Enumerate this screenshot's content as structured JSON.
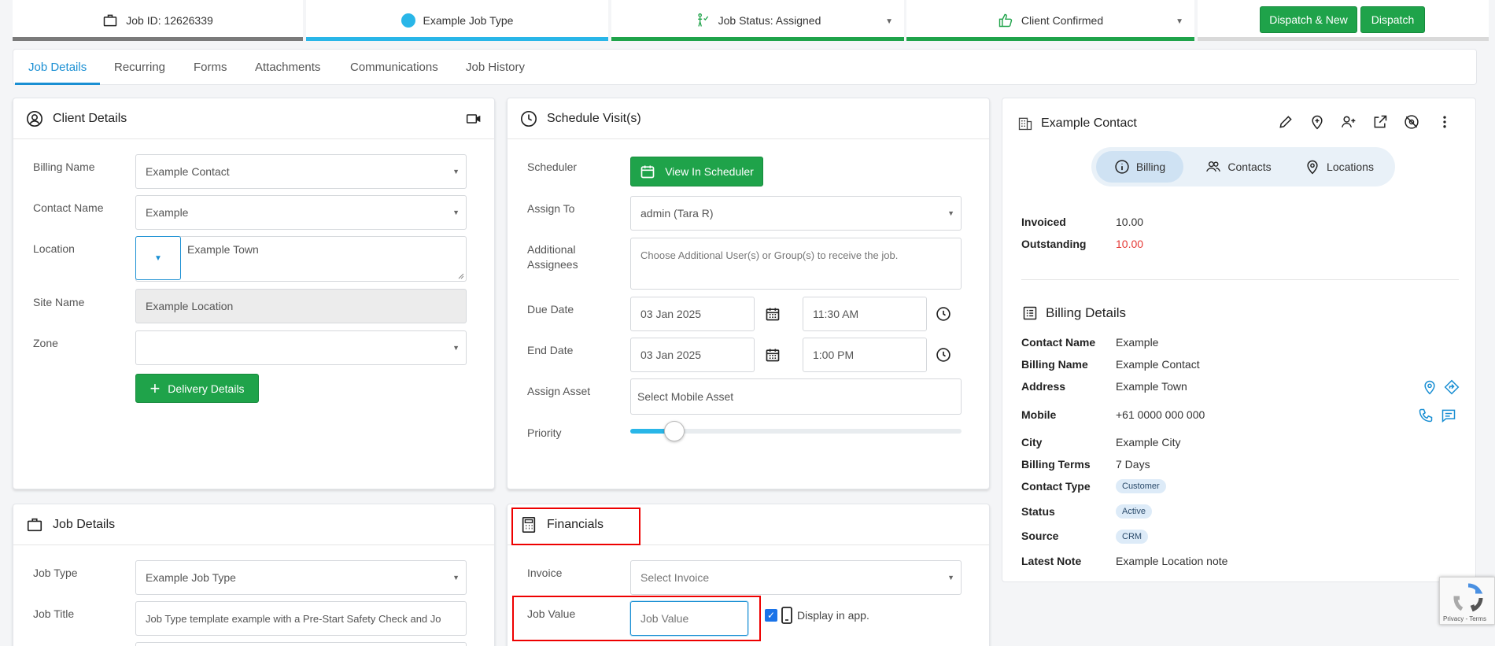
{
  "status_bar": {
    "job_id": "Job ID: 12626339",
    "job_type": "Example Job Type",
    "job_status": "Job Status: Assigned",
    "client_confirmed": "Client Confirmed",
    "dispatch_new_label": "Dispatch & New",
    "dispatch_label": "Dispatch",
    "colors": {
      "job_id": "#7a7a7a",
      "job_type": "#29b6e8",
      "status": "#1fa34a",
      "confirmed": "#1fa34a",
      "actions": "#d9d9d9"
    }
  },
  "tabs": [
    "Job Details",
    "Recurring",
    "Forms",
    "Attachments",
    "Communications",
    "Job History"
  ],
  "client_details": {
    "title": "Client Details",
    "billing_name_label": "Billing Name",
    "billing_name_value": "Example Contact",
    "contact_name_label": "Contact Name",
    "contact_name_value": "Example",
    "location_label": "Location",
    "location_value": "Example Town",
    "site_name_label": "Site Name",
    "site_name_value": "Example Location",
    "zone_label": "Zone",
    "zone_value": "",
    "delivery_button": "Delivery Details"
  },
  "schedule": {
    "title": "Schedule Visit(s)",
    "scheduler_label": "Scheduler",
    "view_scheduler_button": "View In Scheduler",
    "assign_to_label": "Assign To",
    "assign_to_value": "admin (Tara R)",
    "additional_label_1": "Additional",
    "additional_label_2": "Assignees",
    "additional_placeholder": "Choose Additional User(s) or Group(s) to receive the job.",
    "due_date_label": "Due Date",
    "due_date": "03 Jan 2025",
    "due_time": "11:30 AM",
    "end_date_label": "End Date",
    "end_date": "03 Jan 2025",
    "end_time": "1:00 PM",
    "assign_asset_label": "Assign Asset",
    "assign_asset_placeholder": "Select Mobile Asset",
    "priority_label": "Priority",
    "priority_level": 0.1
  },
  "job_details": {
    "title": "Job Details",
    "job_type_label": "Job Type",
    "job_type_value": "Example Job Type",
    "job_title_label": "Job Title",
    "job_title_value": "Job Type template example with a Pre-Start Safety Check and Jo"
  },
  "financials": {
    "title": "Financials",
    "invoice_label": "Invoice",
    "invoice_placeholder": "Select Invoice",
    "job_value_label": "Job Value",
    "job_value_placeholder": "Job Value",
    "display_in_app_label": "Display in app.",
    "display_in_app_checked": true
  },
  "contact_panel": {
    "title": "Example Contact",
    "segments": [
      "Billing",
      "Contacts",
      "Locations"
    ],
    "invoiced_label": "Invoiced",
    "invoiced_value": "10.00",
    "outstanding_label": "Outstanding",
    "outstanding_value": "10.00",
    "billing_details_title": "Billing Details",
    "rows": [
      {
        "label": "Contact Name",
        "value": "Example"
      },
      {
        "label": "Billing Name",
        "value": "Example Contact"
      },
      {
        "label": "Address",
        "value": "Example Town"
      },
      {
        "label": "Mobile",
        "value": "+61 0000 000 000"
      },
      {
        "label": "City",
        "value": "Example City"
      },
      {
        "label": "Billing Terms",
        "value": "7 Days"
      },
      {
        "label": "Contact Type",
        "value": "Customer"
      },
      {
        "label": "Status",
        "value": "Active"
      },
      {
        "label": "Source",
        "value": "CRM"
      },
      {
        "label": "Latest Note",
        "value": "Example Location note"
      }
    ]
  },
  "recaptcha": {
    "label": "Privacy - Terms"
  }
}
